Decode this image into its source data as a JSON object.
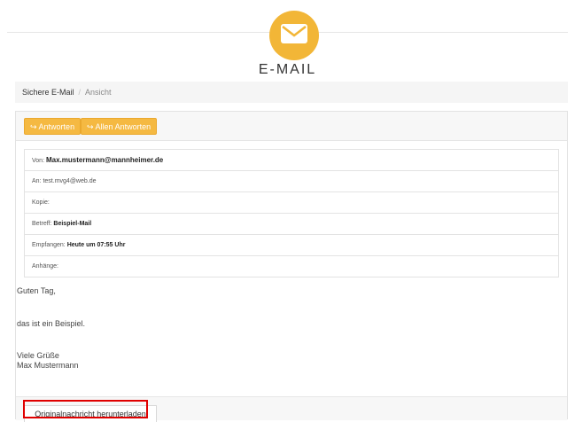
{
  "app": {
    "title": "E-MAIL",
    "icon": "envelope-icon",
    "accent_color": "#f2b637"
  },
  "breadcrumb": {
    "root": "Sichere E-Mail",
    "separator": "/",
    "current": "Ansicht"
  },
  "toolbar": {
    "reply_label": "Antworten",
    "reply_all_label": "Allen Antworten",
    "reply_icon": "reply-arrow-icon"
  },
  "headers": {
    "from_label": "Von:",
    "from_value": "Max.mustermann@mannheimer.de",
    "to_label": "An:",
    "to_value": "test.mvg4@web.de",
    "cc_label": "Kopie:",
    "subject_label": "Betreff:",
    "subject_value": "Beispiel-Mail",
    "received_label": "Empfangen:",
    "received_value": "Heute um 07:55 Uhr",
    "attachments_label": "Anhänge:"
  },
  "message": {
    "greeting": "Guten Tag,",
    "body": "das ist ein Beispiel.",
    "closing": "Viele Grüße",
    "signature": "Max Mustermann"
  },
  "footer": {
    "download_label": "Originalnachricht herunterladen",
    "highlight_color": "#e00000"
  }
}
